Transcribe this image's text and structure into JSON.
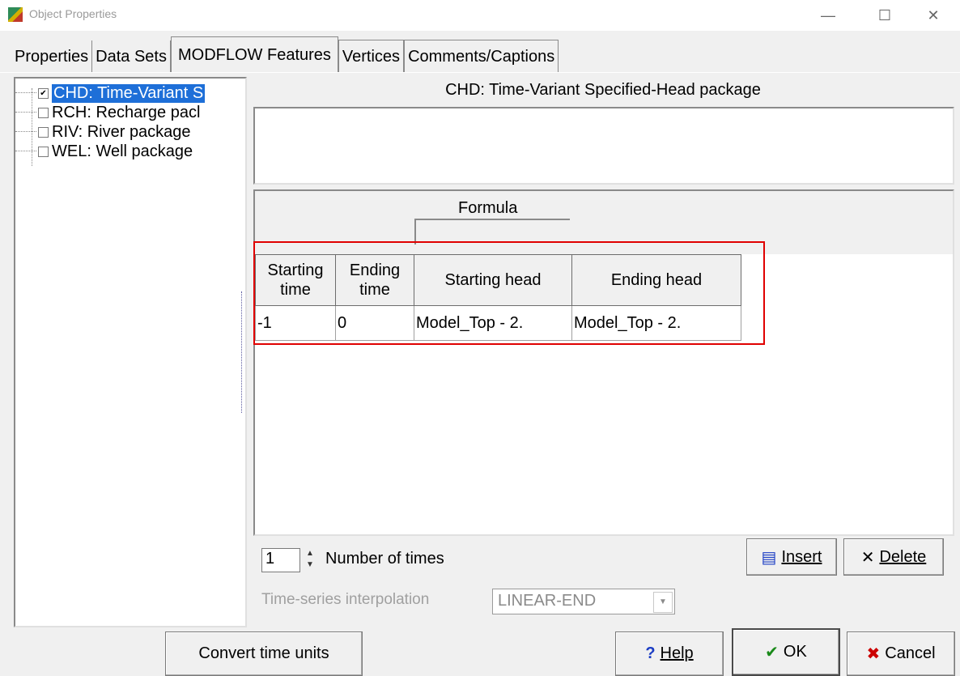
{
  "window": {
    "title": "Object Properties",
    "controls": {
      "minimize": "—",
      "maximize": "☐",
      "close": "✕"
    }
  },
  "tabs": [
    {
      "label": "Properties",
      "active": false
    },
    {
      "label": "Data Sets",
      "active": false
    },
    {
      "label": "MODFLOW Features",
      "active": true
    },
    {
      "label": "Vertices",
      "active": false
    },
    {
      "label": "Comments/Captions",
      "active": false
    }
  ],
  "tree": {
    "items": [
      {
        "label": "CHD: Time-Variant S",
        "checked": true,
        "check_glyph": "✔",
        "selected": true
      },
      {
        "label": "RCH: Recharge pacl",
        "checked": false,
        "check_glyph": "",
        "selected": false
      },
      {
        "label": "RIV: River package",
        "checked": false,
        "check_glyph": "",
        "selected": false
      },
      {
        "label": "WEL: Well package",
        "checked": false,
        "check_glyph": "",
        "selected": false
      }
    ]
  },
  "package": {
    "title": "CHD: Time-Variant Specified-Head package",
    "description": ""
  },
  "grid": {
    "group_label": "Formula",
    "columns": [
      {
        "line1": "Starting",
        "line2": "time"
      },
      {
        "line1": "Ending",
        "line2": "time"
      },
      {
        "line1": "Starting head",
        "line2": ""
      },
      {
        "line1": "Ending head",
        "line2": ""
      }
    ],
    "rows": [
      [
        "-1",
        "0",
        "Model_Top - 2.",
        "Model_Top - 2."
      ]
    ]
  },
  "controls": {
    "number_of_times_value": "1",
    "number_of_times_label": "Number of times",
    "interpolation_label": "Time-series interpolation",
    "interpolation_value": "LINEAR-END",
    "insert_label": "Insert",
    "insert_icon": "▤",
    "delete_label": "Delete",
    "delete_icon": "✕"
  },
  "footer": {
    "convert_label": "Convert time units",
    "help_label": "Help",
    "help_icon": "?",
    "ok_label": "OK",
    "ok_icon": "✔",
    "cancel_label": "Cancel",
    "cancel_icon": "✖"
  },
  "colors": {
    "highlight": "#e00000",
    "selection": "#1e6fd8",
    "help_icon": "#1a3cc4",
    "ok_icon": "#1a8a1a",
    "cancel_icon": "#cc0000"
  }
}
